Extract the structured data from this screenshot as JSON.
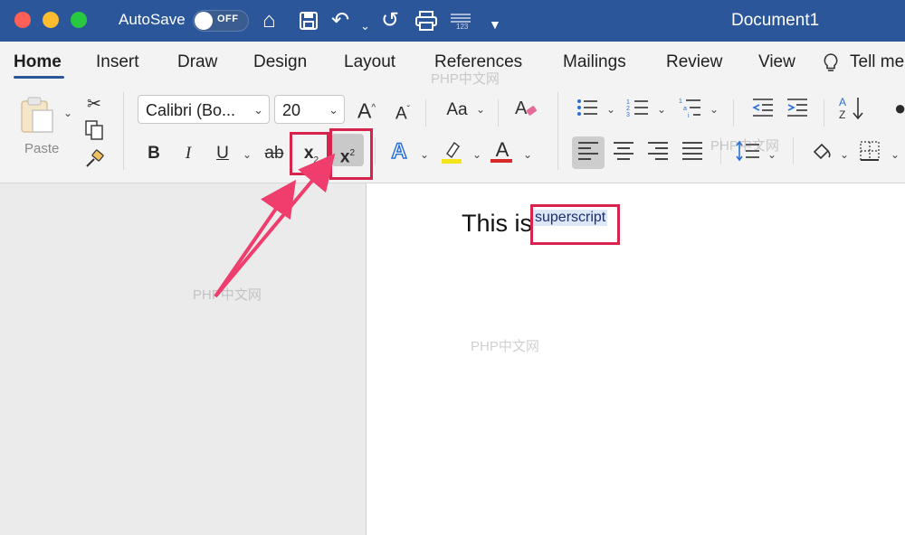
{
  "titlebar": {
    "autosave_label": "AutoSave",
    "autosave_state": "OFF",
    "document_title": "Document1"
  },
  "tabs": [
    "Home",
    "Insert",
    "Draw",
    "Design",
    "Layout",
    "References",
    "Mailings",
    "Review",
    "View",
    "Tell me"
  ],
  "active_tab": "Home",
  "ribbon": {
    "paste_label": "Paste",
    "font_name": "Calibri (Bo...",
    "font_size": "20",
    "grow_font": "A",
    "shrink_font": "A",
    "change_case": "Aa",
    "bold": "B",
    "italic": "I",
    "underline": "U",
    "strikethrough": "ab",
    "subscript": "x",
    "subscript_mark": "2",
    "superscript": "x",
    "superscript_mark": "2",
    "text_effects": "A",
    "font_color": "A",
    "sort_az": "AZ"
  },
  "document": {
    "text": "This is",
    "superscript_text": "superscript"
  },
  "watermarks": [
    "PHP中文网",
    "PHP中文网",
    "PHP中文网",
    "PHP中文网"
  ],
  "colors": {
    "titlebar": "#2b579a",
    "ribbon": "#f3f3f3",
    "highlight": "#d6244d",
    "font_color_bar": "#d62a2a",
    "highlighter_bar": "#f5e41b"
  },
  "icons": [
    "home-icon",
    "save-icon",
    "undo-icon",
    "redo-icon",
    "print-icon",
    "customize-icon",
    "cut-icon",
    "copy-icon",
    "format-painter-icon",
    "bullets-icon",
    "numbering-icon",
    "multilevel-list-icon",
    "decrease-indent-icon",
    "increase-indent-icon",
    "line-spacing-icon",
    "shading-icon",
    "borders-icon",
    "lightbulb-icon"
  ]
}
